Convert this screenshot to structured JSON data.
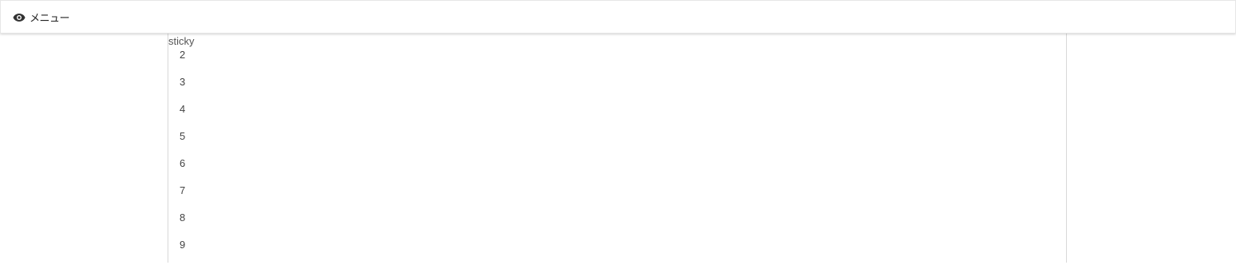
{
  "header": {
    "menu_icon": "eye-icon",
    "menu_label": "メニュー"
  },
  "content": {
    "sticky_label": "sticky",
    "items": [
      "2",
      "3",
      "4",
      "5",
      "6",
      "7",
      "8",
      "9"
    ]
  }
}
